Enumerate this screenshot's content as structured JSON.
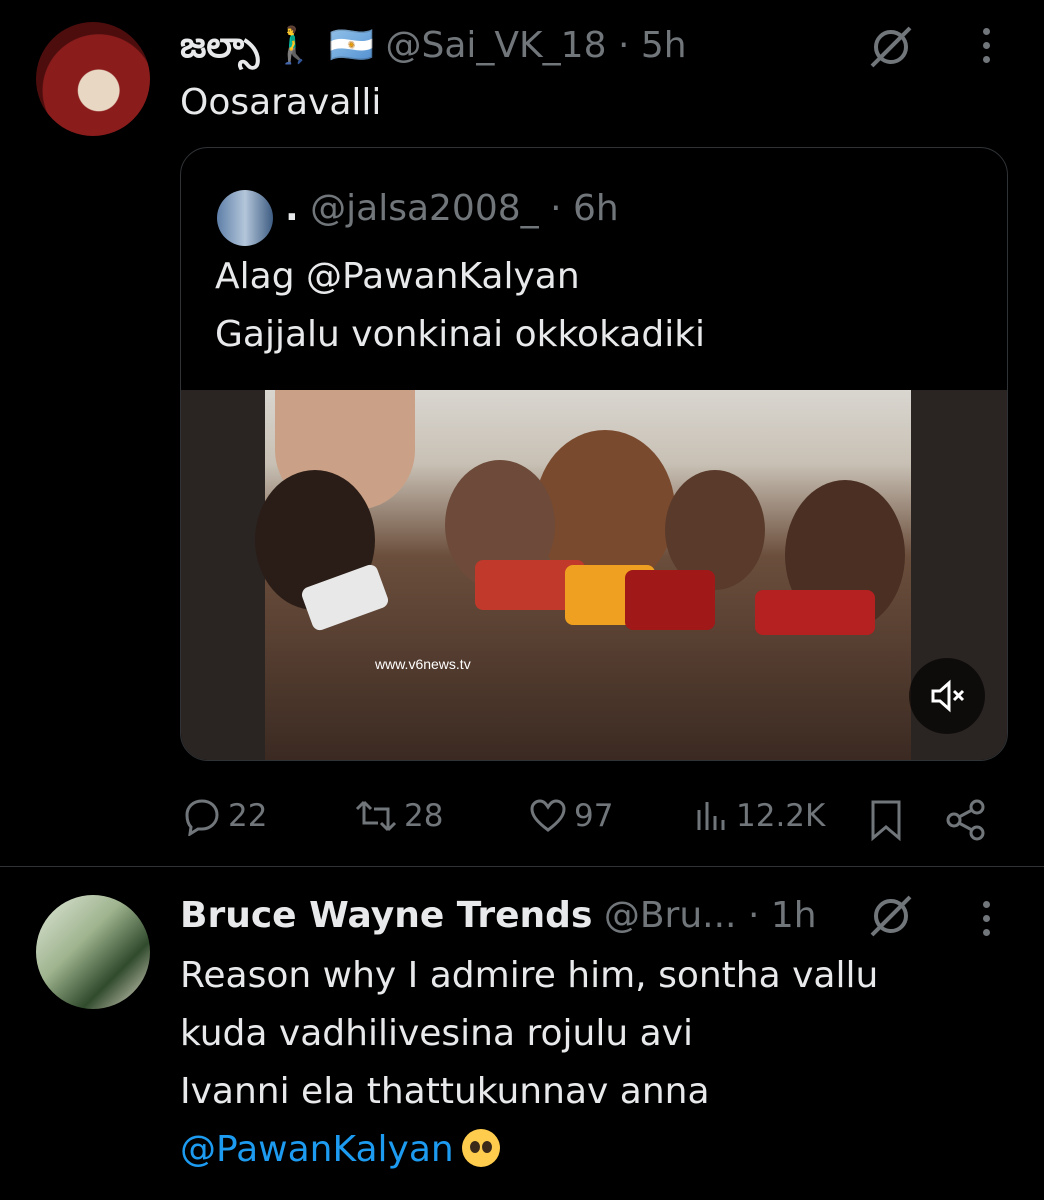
{
  "tweet1": {
    "display_name": "జల్సా 🚶‍♂️ 🇦🇷",
    "handle": "@Sai_VK_18",
    "sep": "·",
    "time": "5h",
    "text": "Oosaravalli",
    "quote": {
      "display_name": ".",
      "handle": "@jalsa2008_",
      "sep": "·",
      "time": "6h",
      "line1": "Alag @PawanKalyan",
      "line2": "Gajjalu vonkinai okkokadiki",
      "video_watermark": "www.v6news.tv"
    },
    "actions": {
      "replies": "22",
      "reposts": "28",
      "likes": "97",
      "views": "12.2K"
    }
  },
  "tweet2": {
    "display_name": "Bruce Wayne Trends",
    "handle": "@Bru...",
    "sep": "·",
    "time": "1h",
    "line1": "Reason why I admire him, sontha vallu",
    "line2": "kuda vadhilivesina rojulu avi",
    "line3": "Ivanni ela thattukunnav anna",
    "mention": "@PawanKalyan"
  },
  "colors": {
    "background": "#000000",
    "text": "#e7e9ea",
    "muted": "#71767b",
    "link": "#1d9bf0",
    "border": "#2f3336"
  }
}
